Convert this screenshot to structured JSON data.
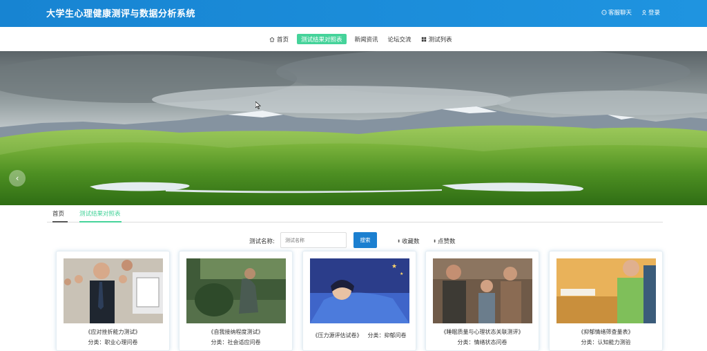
{
  "header": {
    "title": "大学生心理健康测评与数据分析系统",
    "chat_label": "客服聊天",
    "login_label": "登录"
  },
  "nav": {
    "items": [
      {
        "label": "首页",
        "icon": "home-icon"
      },
      {
        "label": "测试结果对照表",
        "active": true
      },
      {
        "label": "新闻资讯"
      },
      {
        "label": "论坛交流"
      },
      {
        "label": "测试列表",
        "icon": "grid-icon"
      }
    ]
  },
  "tabs": {
    "home": "首页",
    "result": "测试结果对照表"
  },
  "search": {
    "label": "测试名称:",
    "placeholder": "测试名称",
    "button": "搜索",
    "sort_fav": "收藏数",
    "sort_like": "点赞数"
  },
  "cards": [
    {
      "name": "《应对挫折能力测试》",
      "category": "分类：职业心理问卷"
    },
    {
      "name": "《自我接纳程度测试》",
      "category": "分类：社会适应问卷"
    },
    {
      "name": "《压力源评估试卷》",
      "category": "分类：抑郁问卷"
    },
    {
      "name": "《睡眠质量与心理状态关联测评》",
      "category": "分类：情绪状态问卷"
    },
    {
      "name": "《抑郁情绪筛查量表》",
      "category": "分类：认知能力测验"
    }
  ],
  "colors": {
    "header": "#1a8cd8",
    "accent_green": "#45d39a",
    "button_blue": "#1b7fd0"
  }
}
